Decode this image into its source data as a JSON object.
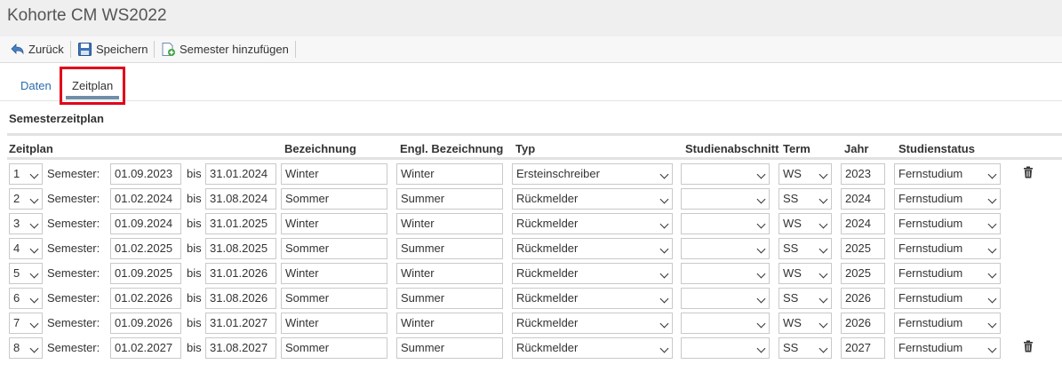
{
  "window": {
    "title": "Kohorte CM WS2022"
  },
  "toolbar": {
    "back_label": "Zurück",
    "save_label": "Speichern",
    "add_semester_label": "Semester hinzufügen"
  },
  "tabs": [
    {
      "label": "Daten",
      "active": false
    },
    {
      "label": "Zeitplan",
      "active": true
    }
  ],
  "section": {
    "title": "Semesterzeitplan"
  },
  "table": {
    "headers": {
      "zeitplan": "Zeitplan",
      "bezeichnung": "Bezeichnung",
      "engl_bezeichnung": "Engl. Bezeichnung",
      "typ": "Typ",
      "studienabschnitt": "Studienabschnitt",
      "term": "Term",
      "jahr": "Jahr",
      "studienstatus": "Studienstatus"
    },
    "semester_label": "Semester:",
    "bis_label": "bis",
    "rows": [
      {
        "num": "1",
        "from": "01.09.2023",
        "to": "31.01.2024",
        "name": "Winter",
        "name_en": "Winter",
        "typ": "Ersteinschreiber",
        "abschnitt": "",
        "term": "WS",
        "jahr": "2023",
        "status": "Fernstudium",
        "deletable": true
      },
      {
        "num": "2",
        "from": "01.02.2024",
        "to": "31.08.2024",
        "name": "Sommer",
        "name_en": "Summer",
        "typ": "Rückmelder",
        "abschnitt": "",
        "term": "SS",
        "jahr": "2024",
        "status": "Fernstudium",
        "deletable": false
      },
      {
        "num": "3",
        "from": "01.09.2024",
        "to": "31.01.2025",
        "name": "Winter",
        "name_en": "Winter",
        "typ": "Rückmelder",
        "abschnitt": "",
        "term": "WS",
        "jahr": "2024",
        "status": "Fernstudium",
        "deletable": false
      },
      {
        "num": "4",
        "from": "01.02.2025",
        "to": "31.08.2025",
        "name": "Sommer",
        "name_en": "Summer",
        "typ": "Rückmelder",
        "abschnitt": "",
        "term": "SS",
        "jahr": "2025",
        "status": "Fernstudium",
        "deletable": false
      },
      {
        "num": "5",
        "from": "01.09.2025",
        "to": "31.01.2026",
        "name": "Winter",
        "name_en": "Winter",
        "typ": "Rückmelder",
        "abschnitt": "",
        "term": "WS",
        "jahr": "2025",
        "status": "Fernstudium",
        "deletable": false
      },
      {
        "num": "6",
        "from": "01.02.2026",
        "to": "31.08.2026",
        "name": "Sommer",
        "name_en": "Summer",
        "typ": "Rückmelder",
        "abschnitt": "",
        "term": "SS",
        "jahr": "2026",
        "status": "Fernstudium",
        "deletable": false
      },
      {
        "num": "7",
        "from": "01.09.2026",
        "to": "31.01.2027",
        "name": "Winter",
        "name_en": "Winter",
        "typ": "Rückmelder",
        "abschnitt": "",
        "term": "WS",
        "jahr": "2026",
        "status": "Fernstudium",
        "deletable": false
      },
      {
        "num": "8",
        "from": "01.02.2027",
        "to": "31.08.2027",
        "name": "Sommer",
        "name_en": "Summer",
        "typ": "Rückmelder",
        "abschnitt": "",
        "term": "SS",
        "jahr": "2027",
        "status": "Fernstudium",
        "deletable": true
      }
    ]
  },
  "icons": {
    "back": "back-arrow-icon",
    "save": "floppy-disk-icon",
    "add": "add-document-icon",
    "delete": "trash-icon"
  },
  "colors": {
    "link": "#2a6bb0",
    "highlight": "#e0001a",
    "tab_underline": "#6f8fa8"
  }
}
